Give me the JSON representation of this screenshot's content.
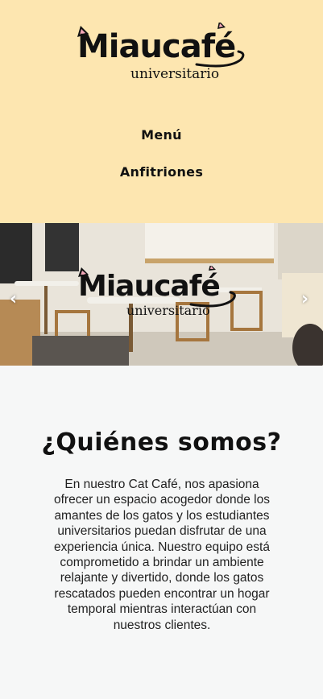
{
  "header": {
    "logo_word": "Miaucafé",
    "logo_sub": "universitario",
    "nav": [
      {
        "label": "Menú"
      },
      {
        "label": "Anfitriones"
      }
    ]
  },
  "hero": {
    "logo_word": "Miaucafé",
    "logo_sub": "universitario",
    "prev_label": "‹",
    "next_label": "›"
  },
  "about": {
    "title": "¿Quiénes somos?",
    "body": "En nuestro Cat Café, nos apasiona ofrecer un espacio acogedor donde los amantes de los gatos y los estudiantes universitarios puedan disfrutar de una experiencia única. Nuestro equipo está comprometido a brindar un ambiente relajante y divertido, donde los gatos rescatados pueden encontrar un hogar temporal mientras interactúan con nuestros clientes."
  },
  "colors": {
    "header_bg": "#fde6b0",
    "page_bg": "#f6f7f7",
    "text": "#111111",
    "cat_ear_pink": "#f2a7b8"
  }
}
